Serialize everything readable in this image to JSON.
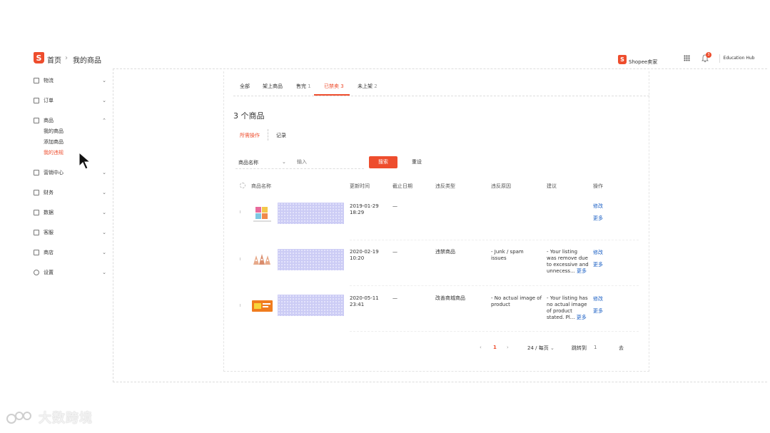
{
  "breadcrumb": {
    "home": "首页",
    "separator": "›",
    "current": "我的商品"
  },
  "header": {
    "shopee_label": "Shopee卖家",
    "notification_count": "3",
    "education_hub": "Education Hub"
  },
  "sidebar": {
    "items": [
      {
        "label": "物流",
        "icon": "truck-icon",
        "chevron": "⌄"
      },
      {
        "label": "订单",
        "icon": "clipboard-icon",
        "chevron": "⌄"
      },
      {
        "label": "商品",
        "icon": "box-icon",
        "chevron": "⌃"
      },
      {
        "label": "营销中心",
        "icon": "tag-icon",
        "chevron": "⌄"
      },
      {
        "label": "财务",
        "icon": "wallet-icon",
        "chevron": "⌄"
      },
      {
        "label": "数据",
        "icon": "chart-icon",
        "chevron": "⌄"
      },
      {
        "label": "客服",
        "icon": "chat-icon",
        "chevron": "⌄"
      },
      {
        "label": "商店",
        "icon": "store-icon",
        "chevron": "⌄"
      },
      {
        "label": "设置",
        "icon": "gear-icon",
        "chevron": "⌄"
      }
    ],
    "product_sub": [
      "我的商品",
      "添加商品",
      "我的违规"
    ]
  },
  "tabs": [
    {
      "label": "全部",
      "count": ""
    },
    {
      "label": "架上商品",
      "count": ""
    },
    {
      "label": "售完",
      "count": "1"
    },
    {
      "label": "已禁卖",
      "count": "3"
    },
    {
      "label": "未上架",
      "count": "2"
    }
  ],
  "count_title": "3 个商品",
  "subtabs": [
    "所需操作",
    "记录"
  ],
  "filter": {
    "select": "商品名称",
    "placeholder": "输入",
    "search": "搜索",
    "reset": "重设"
  },
  "columns": [
    "商品名称",
    "更新时间",
    "截止日期",
    "违反类型",
    "违反原因",
    "建议",
    "操作"
  ],
  "rows": [
    {
      "updated_date": "2019-01-29",
      "updated_time": "18:29",
      "deadline": "—",
      "type": "",
      "reason_1": "",
      "reason_2": "",
      "suggestion_1": "",
      "suggestion_2": "",
      "suggestion_3": "",
      "suggestion_4": "",
      "more_inline": "",
      "edit": "修改",
      "more": "更多"
    },
    {
      "updated_date": "2020-02-19",
      "updated_time": "10:20",
      "deadline": "—",
      "type": "违禁商品",
      "reason_1": "- Junk / spam",
      "reason_2": "issues",
      "suggestion_1": "- Your listing",
      "suggestion_2": "was remove due",
      "suggestion_3": "to excessive and",
      "suggestion_4": "unnecess...",
      "more_inline": "更多",
      "edit": "修改",
      "more": "更多"
    },
    {
      "updated_date": "2020-05-11",
      "updated_time": "23:41",
      "deadline": "—",
      "type": "改善商城商品",
      "reason_1": "- No actual image of",
      "reason_2": "product",
      "suggestion_1": "- Your listing has",
      "suggestion_2": "no actual image",
      "suggestion_3": "of product",
      "suggestion_4": "stated. Pl...",
      "more_inline": "更多",
      "edit": "修改",
      "more": "更多"
    }
  ],
  "pagination": {
    "prev": "‹",
    "page": "1",
    "next": "›",
    "per_page": "24 / 每页",
    "jump_label": "跳转到",
    "jump_value": "1",
    "go": "去"
  },
  "watermark": "大数跨境",
  "colors": {
    "accent": "#ee4d2d",
    "link": "#1a5fc4"
  }
}
